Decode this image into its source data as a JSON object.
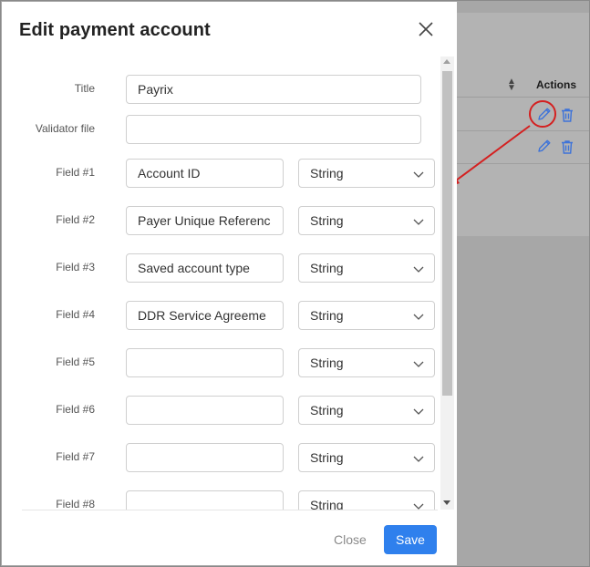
{
  "modal": {
    "title": "Edit payment account",
    "fields": {
      "title": {
        "label": "Title",
        "value": "Payrix"
      },
      "validator": {
        "label": "Validator file",
        "value": ""
      },
      "custom": [
        {
          "label": "Field #1",
          "value": "Account ID",
          "type": "String"
        },
        {
          "label": "Field #2",
          "value": "Payer Unique Referenc",
          "type": "String"
        },
        {
          "label": "Field #3",
          "value": "Saved account type",
          "type": "String"
        },
        {
          "label": "Field #4",
          "value": "DDR Service Agreeme",
          "type": "String"
        },
        {
          "label": "Field #5",
          "value": "",
          "type": "String"
        },
        {
          "label": "Field #6",
          "value": "",
          "type": "String"
        },
        {
          "label": "Field #7",
          "value": "",
          "type": "String"
        },
        {
          "label": "Field #8",
          "value": "",
          "type": "String"
        }
      ]
    },
    "footer": {
      "close_label": "Close",
      "save_label": "Save"
    }
  },
  "background": {
    "table_header_actions": "Actions"
  },
  "colors": {
    "primary": "#2f80ed",
    "annotation": "#d42020",
    "icon_blue": "#3d73d9"
  }
}
